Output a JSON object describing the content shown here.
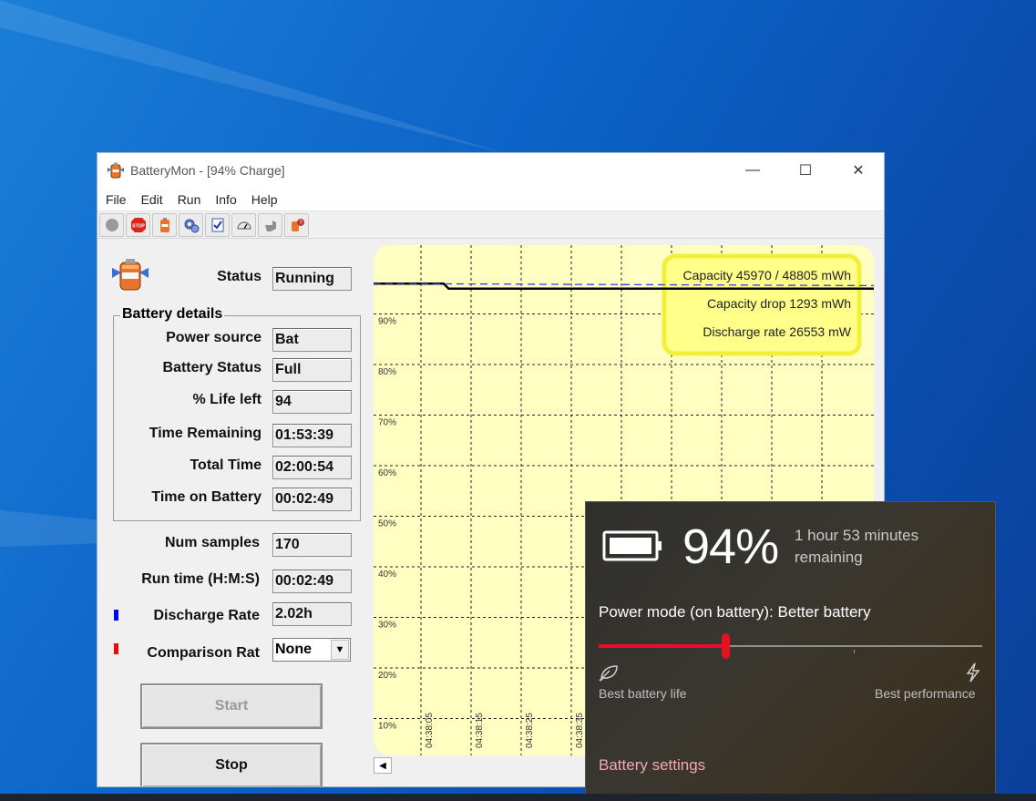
{
  "window": {
    "title": "BatteryMon - [94% Charge]",
    "controls": {
      "minimize": "—",
      "maximize": "☐",
      "close": "✕"
    }
  },
  "menu": [
    "File",
    "Edit",
    "Run",
    "Info",
    "Help"
  ],
  "toolbar_icons": [
    "record-icon",
    "stop-icon",
    "battery-icon",
    "gears-icon",
    "checklist-icon",
    "gauge-icon",
    "pointer-icon",
    "about-icon"
  ],
  "status": {
    "label": "Status",
    "value": "Running"
  },
  "battery_details": {
    "title": "Battery details",
    "fields": [
      {
        "label": "Power source",
        "value": "Bat"
      },
      {
        "label": "Battery Status",
        "value": "Full"
      },
      {
        "label": "% Life left",
        "value": "94"
      },
      {
        "label": "Time Remaining",
        "value": "01:53:39"
      },
      {
        "label": "Total Time",
        "value": "02:00:54"
      },
      {
        "label": "Time on Battery",
        "value": "00:02:49"
      }
    ]
  },
  "stats": {
    "num_samples": {
      "label": "Num samples",
      "value": "170"
    },
    "run_time": {
      "label": "Run time (H:M:S)",
      "value": "00:02:49"
    },
    "discharge_rate": {
      "label": "Discharge Rate",
      "value": "2.02h",
      "color": "#0000ff"
    },
    "comparison": {
      "label": "Comparison Rat",
      "value": "None",
      "color": "#ff0000"
    }
  },
  "buttons": {
    "start": "Start",
    "stop": "Stop"
  },
  "chart_data": {
    "type": "line",
    "y_ticks": [
      "90%",
      "80%",
      "70%",
      "60%",
      "50%",
      "40%",
      "30%",
      "20%",
      "10%"
    ],
    "x_ticks": [
      "04:38:05",
      "04:38:15",
      "04:38:25",
      "04:38:35"
    ],
    "ylim": [
      0,
      100
    ],
    "grid": true,
    "series": [
      {
        "color": "#000000",
        "x": [
          0,
          14,
          15,
          100
        ],
        "y": [
          96,
          96,
          95,
          95
        ]
      },
      {
        "color": "#3c3cff",
        "dashed": true,
        "x": [
          0,
          100
        ],
        "y": [
          96,
          95.6
        ]
      }
    ],
    "annotations": [
      "Capacity 45970 / 48805 mWh",
      "Capacity drop 1293 mWh",
      "Discharge rate 26553 mW"
    ]
  },
  "flyout": {
    "percent": "94%",
    "remaining_line1": "1 hour 53 minutes",
    "remaining_line2": "remaining",
    "power_mode": "Power mode (on battery): Better battery",
    "slider_value": 0.33,
    "best_life": "Best battery life",
    "best_perf": "Best performance",
    "settings_link": "Battery settings",
    "accent": "#e81123"
  }
}
